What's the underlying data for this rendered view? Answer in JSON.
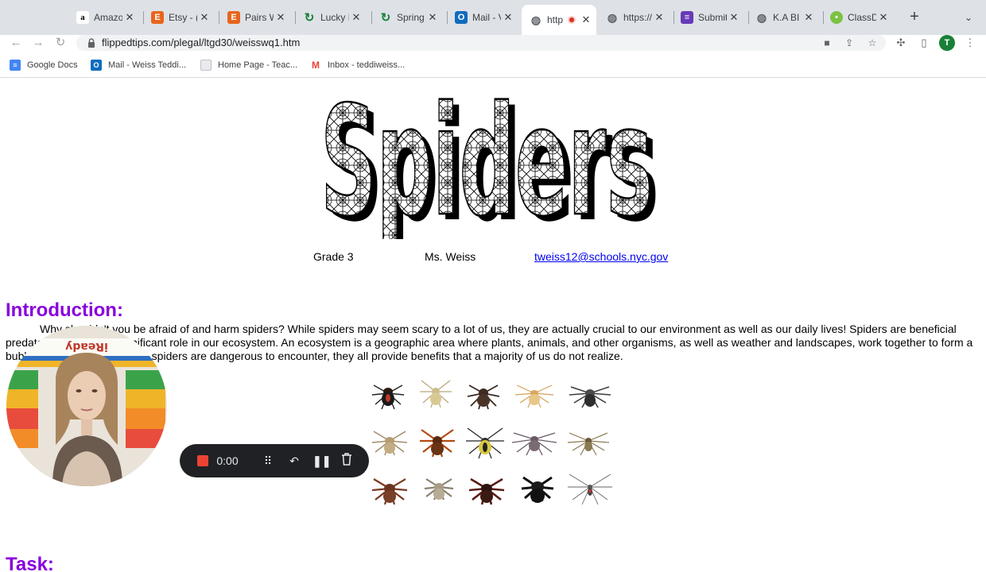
{
  "tabs": [
    {
      "label": "Amazo",
      "icon": "amazon-icon"
    },
    {
      "label": "Etsy - (",
      "icon": "etsy-icon"
    },
    {
      "label": "Pairs W",
      "icon": "etsy-icon"
    },
    {
      "label": "Lucky I",
      "icon": "refresh-icon"
    },
    {
      "label": "Spring",
      "icon": "refresh-icon"
    },
    {
      "label": "Mail - V",
      "icon": "outlook-icon"
    },
    {
      "label": "http",
      "icon": "globe-icon",
      "active": true,
      "recording": true
    },
    {
      "label": "https://",
      "icon": "globe-icon"
    },
    {
      "label": "Submit",
      "icon": "forms-icon"
    },
    {
      "label": "K.A BI",
      "icon": "globe-icon"
    },
    {
      "label": "ClassD",
      "icon": "classdojo-icon"
    }
  ],
  "address": {
    "url": "flippedtips.com/plegal/ltgd30/weisswq1.htm"
  },
  "profile": {
    "initial": "T"
  },
  "bookmarks": [
    {
      "label": "Google Docs",
      "icon": "docs-icon"
    },
    {
      "label": "Mail - Weiss Teddi...",
      "icon": "outlook-icon"
    },
    {
      "label": "Home Page - Teac...",
      "icon": "page-icon"
    },
    {
      "label": "Inbox - teddiweiss...",
      "icon": "gmail-icon"
    }
  ],
  "page": {
    "title_art": "Spiders",
    "grade": "Grade 3",
    "teacher": "Ms. Weiss",
    "email": "tweiss12@schools.nyc.gov",
    "intro_heading": "Introduction:",
    "intro_text": "Why shouldn't you be afraid of and harm spiders? While spiders may seem scary to a lot of us, they are actually crucial to our environment as well as our daily lives! Spiders are beneficial predators and serve a significant role in our ecosystem. An ecosystem is a geographic area where plants, animals, and other organisms, as well as weather and landscapes, work together to form a bubble of life. Although some spiders are dangerous to encounter, they all provide benefits that a majority of us do not realize.",
    "task_heading": "Task:"
  },
  "webcam": {
    "banner_text": "iReady"
  },
  "recorder": {
    "time": "0:00"
  },
  "colors": {
    "heading": "#8800dd",
    "link": "#0000ee",
    "record": "#ea4335"
  }
}
